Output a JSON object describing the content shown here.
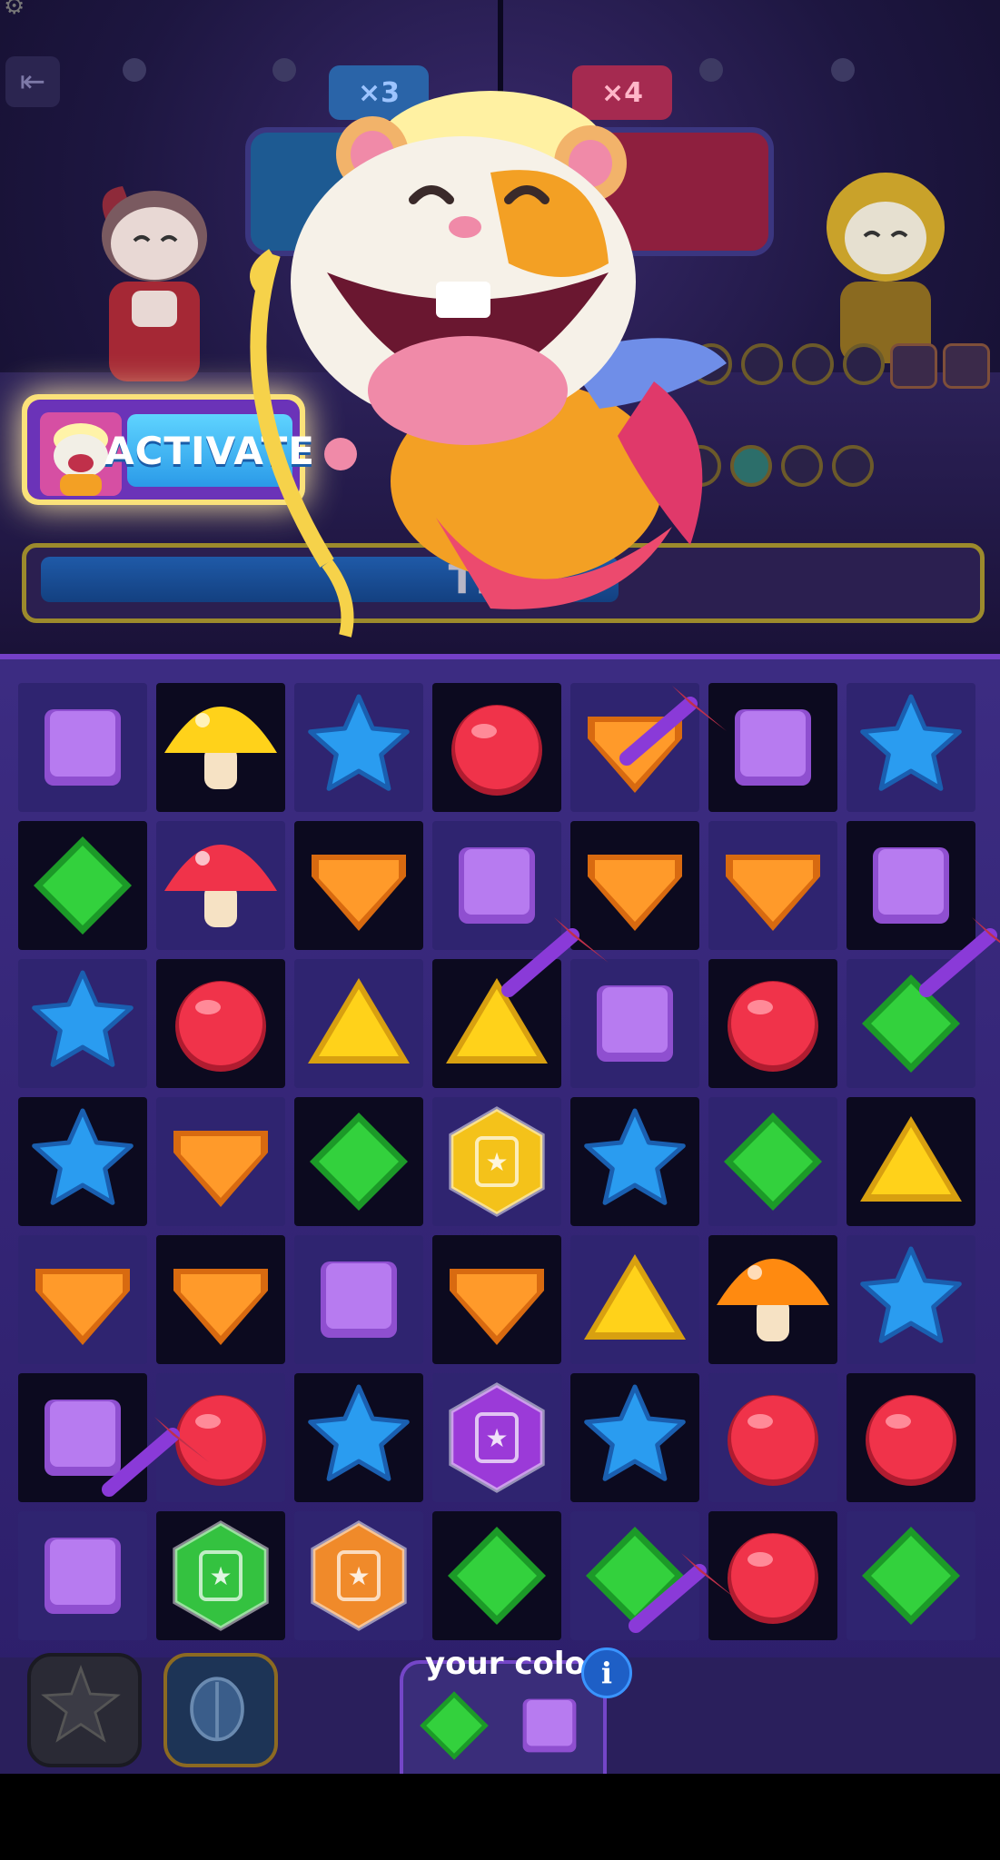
{
  "top": {
    "multiplier_blue": "×3",
    "multiplier_red": "×4",
    "activate_label": "ACTIVATE",
    "time_label": "Time",
    "time_progress": 0.63,
    "score_dots_top": [
      false,
      false,
      false,
      false
    ],
    "score_dots_bottom": [
      false,
      true,
      false,
      false
    ]
  },
  "board": {
    "columns": 7,
    "rows": 7,
    "grid": [
      [
        "purple-square",
        "yellow-mushroom",
        "blue-star",
        "red-circle",
        "orange-diamond",
        "purple-square",
        "blue-star"
      ],
      [
        "green-rhombus",
        "red-mushroom",
        "orange-diamond",
        "purple-square",
        "orange-diamond",
        "orange-diamond",
        "purple-square"
      ],
      [
        "blue-star",
        "red-circle",
        "yellow-triangle",
        "yellow-triangle",
        "purple-square",
        "red-circle",
        "green-rhombus"
      ],
      [
        "blue-star",
        "orange-diamond",
        "green-rhombus",
        "gold-book-token",
        "blue-star",
        "green-rhombus",
        "yellow-triangle"
      ],
      [
        "orange-diamond",
        "orange-diamond",
        "purple-square",
        "orange-diamond",
        "yellow-triangle",
        "orange-mushroom",
        "blue-star"
      ],
      [
        "purple-square",
        "red-circle",
        "blue-star",
        "purple-book-token",
        "blue-star",
        "red-circle",
        "red-circle"
      ],
      [
        "purple-square",
        "green-book-token",
        "orange-book-token",
        "green-rhombus",
        "green-rhombus",
        "red-circle",
        "green-rhombus"
      ]
    ],
    "tile_shading": [
      [
        "light",
        "dark",
        "light",
        "dark",
        "light",
        "dark",
        "light"
      ],
      [
        "dark",
        "light",
        "dark",
        "light",
        "dark",
        "light",
        "dark"
      ],
      [
        "light",
        "dark",
        "light",
        "dark",
        "light",
        "dark",
        "light"
      ],
      [
        "dark",
        "light",
        "dark",
        "light",
        "dark",
        "light",
        "dark"
      ],
      [
        "light",
        "dark",
        "light",
        "dark",
        "light",
        "dark",
        "light"
      ],
      [
        "dark",
        "light",
        "dark",
        "light",
        "dark",
        "light",
        "dark"
      ],
      [
        "light",
        "dark",
        "light",
        "dark",
        "light",
        "dark",
        "light"
      ]
    ]
  },
  "footer": {
    "your_colors_label": "your colors",
    "info_label": "i",
    "your_colors": [
      "green-rhombus",
      "purple-square"
    ]
  },
  "colors": {
    "purple": "#b77bf0",
    "green": "#33d13d",
    "blue": "#2a9cf0",
    "red": "#f0334a",
    "orange": "#ff9a2a",
    "yellow": "#ffd21a",
    "accent_purple": "#7446c8"
  }
}
